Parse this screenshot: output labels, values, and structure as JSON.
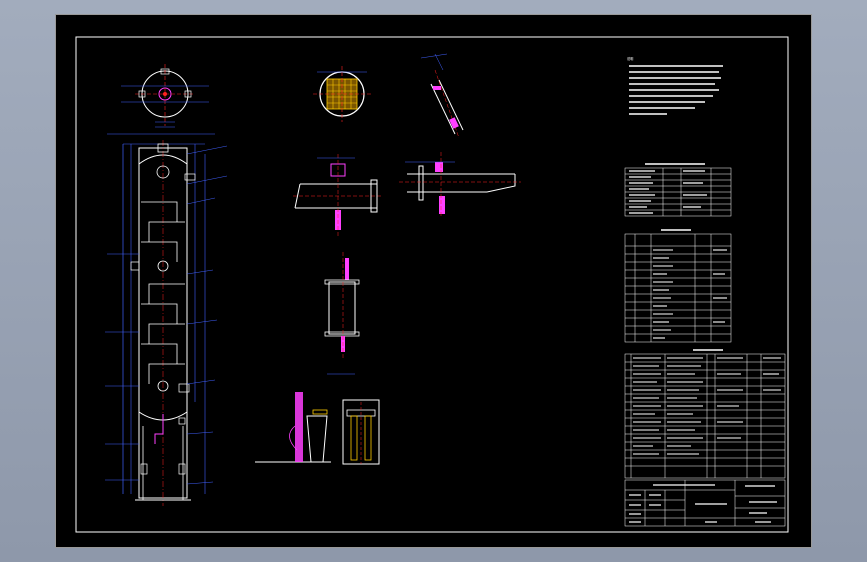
{
  "drawing": {
    "notes_heading": "说明",
    "colors": {
      "background_outer": "#98a2b4",
      "sheet": "#000000",
      "line_white": "#ffffff",
      "line_blue": "#4060ff",
      "line_red": "#ff2020",
      "line_magenta": "#ff40ff",
      "line_yellow": "#ffcc00",
      "line_cyan": "#40e0ff"
    },
    "icons": [
      "tower-elevation-view",
      "top-plan-view",
      "tray-section-view",
      "nozzle-detail",
      "support-detail"
    ]
  }
}
